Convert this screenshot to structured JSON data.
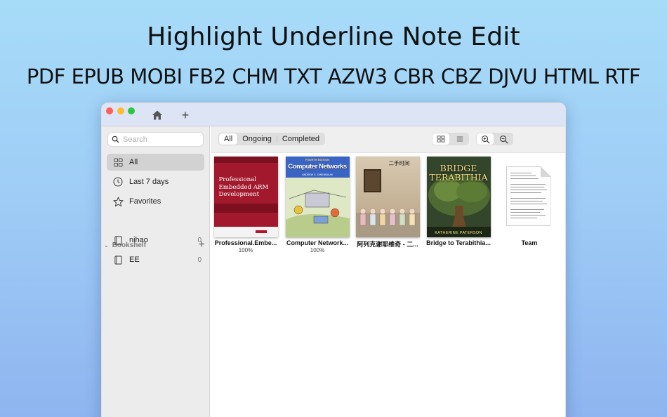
{
  "headline": {
    "features": "Highlight Underline Note Edit",
    "formats": "PDF EPUB MOBI FB2 CHM TXT AZW3 CBR CBZ DJVU HTML RTF"
  },
  "sidebar": {
    "search_placeholder": "Search",
    "items": [
      {
        "label": "All",
        "icon": "grid-icon",
        "active": true
      },
      {
        "label": "Last 7 days",
        "icon": "clock-icon"
      },
      {
        "label": "Favorites",
        "icon": "star-icon"
      }
    ],
    "bookshelf_title": "Bookshelf",
    "shelves": [
      {
        "label": "nihao",
        "count": "0",
        "icon": "book-icon"
      },
      {
        "label": "EE",
        "count": "0",
        "icon": "book-icon"
      }
    ]
  },
  "toolbar": {
    "filters": [
      "All",
      "Ongoing",
      "Completed"
    ],
    "selected_filter": "All"
  },
  "books": [
    {
      "title": "Professional.Embe...",
      "progress": "100%",
      "cover": {
        "title": "Professional Embedded ARM Development",
        "color": "#a2182c"
      }
    },
    {
      "title": "Computer Network...",
      "progress": "100%",
      "cover": {
        "edition": "FOURTH EDITION",
        "title": "Computer Networks",
        "author": "ANDREW S. TANENBAUM",
        "color": "#3a64c4"
      }
    },
    {
      "title": "阿列克谢耶维奇 - 二...",
      "progress": "",
      "cover": {
        "title": "二手时间",
        "color": "#c9b79c"
      }
    },
    {
      "title": "Bridge to Terabithia...",
      "progress": "",
      "cover": {
        "title_line1": "BRIDGE",
        "title_line2": "TERABITHIA",
        "author": "KATHERINE PATERSON",
        "color": "#2b3a24"
      }
    },
    {
      "title": "Team",
      "progress": "",
      "cover": {
        "type": "text-document"
      }
    }
  ],
  "colors": {
    "background_top": "#a7dcf8",
    "background_bottom": "#8fb5f0",
    "titlebar": "#dde4f6",
    "sidebar": "#ececec"
  }
}
